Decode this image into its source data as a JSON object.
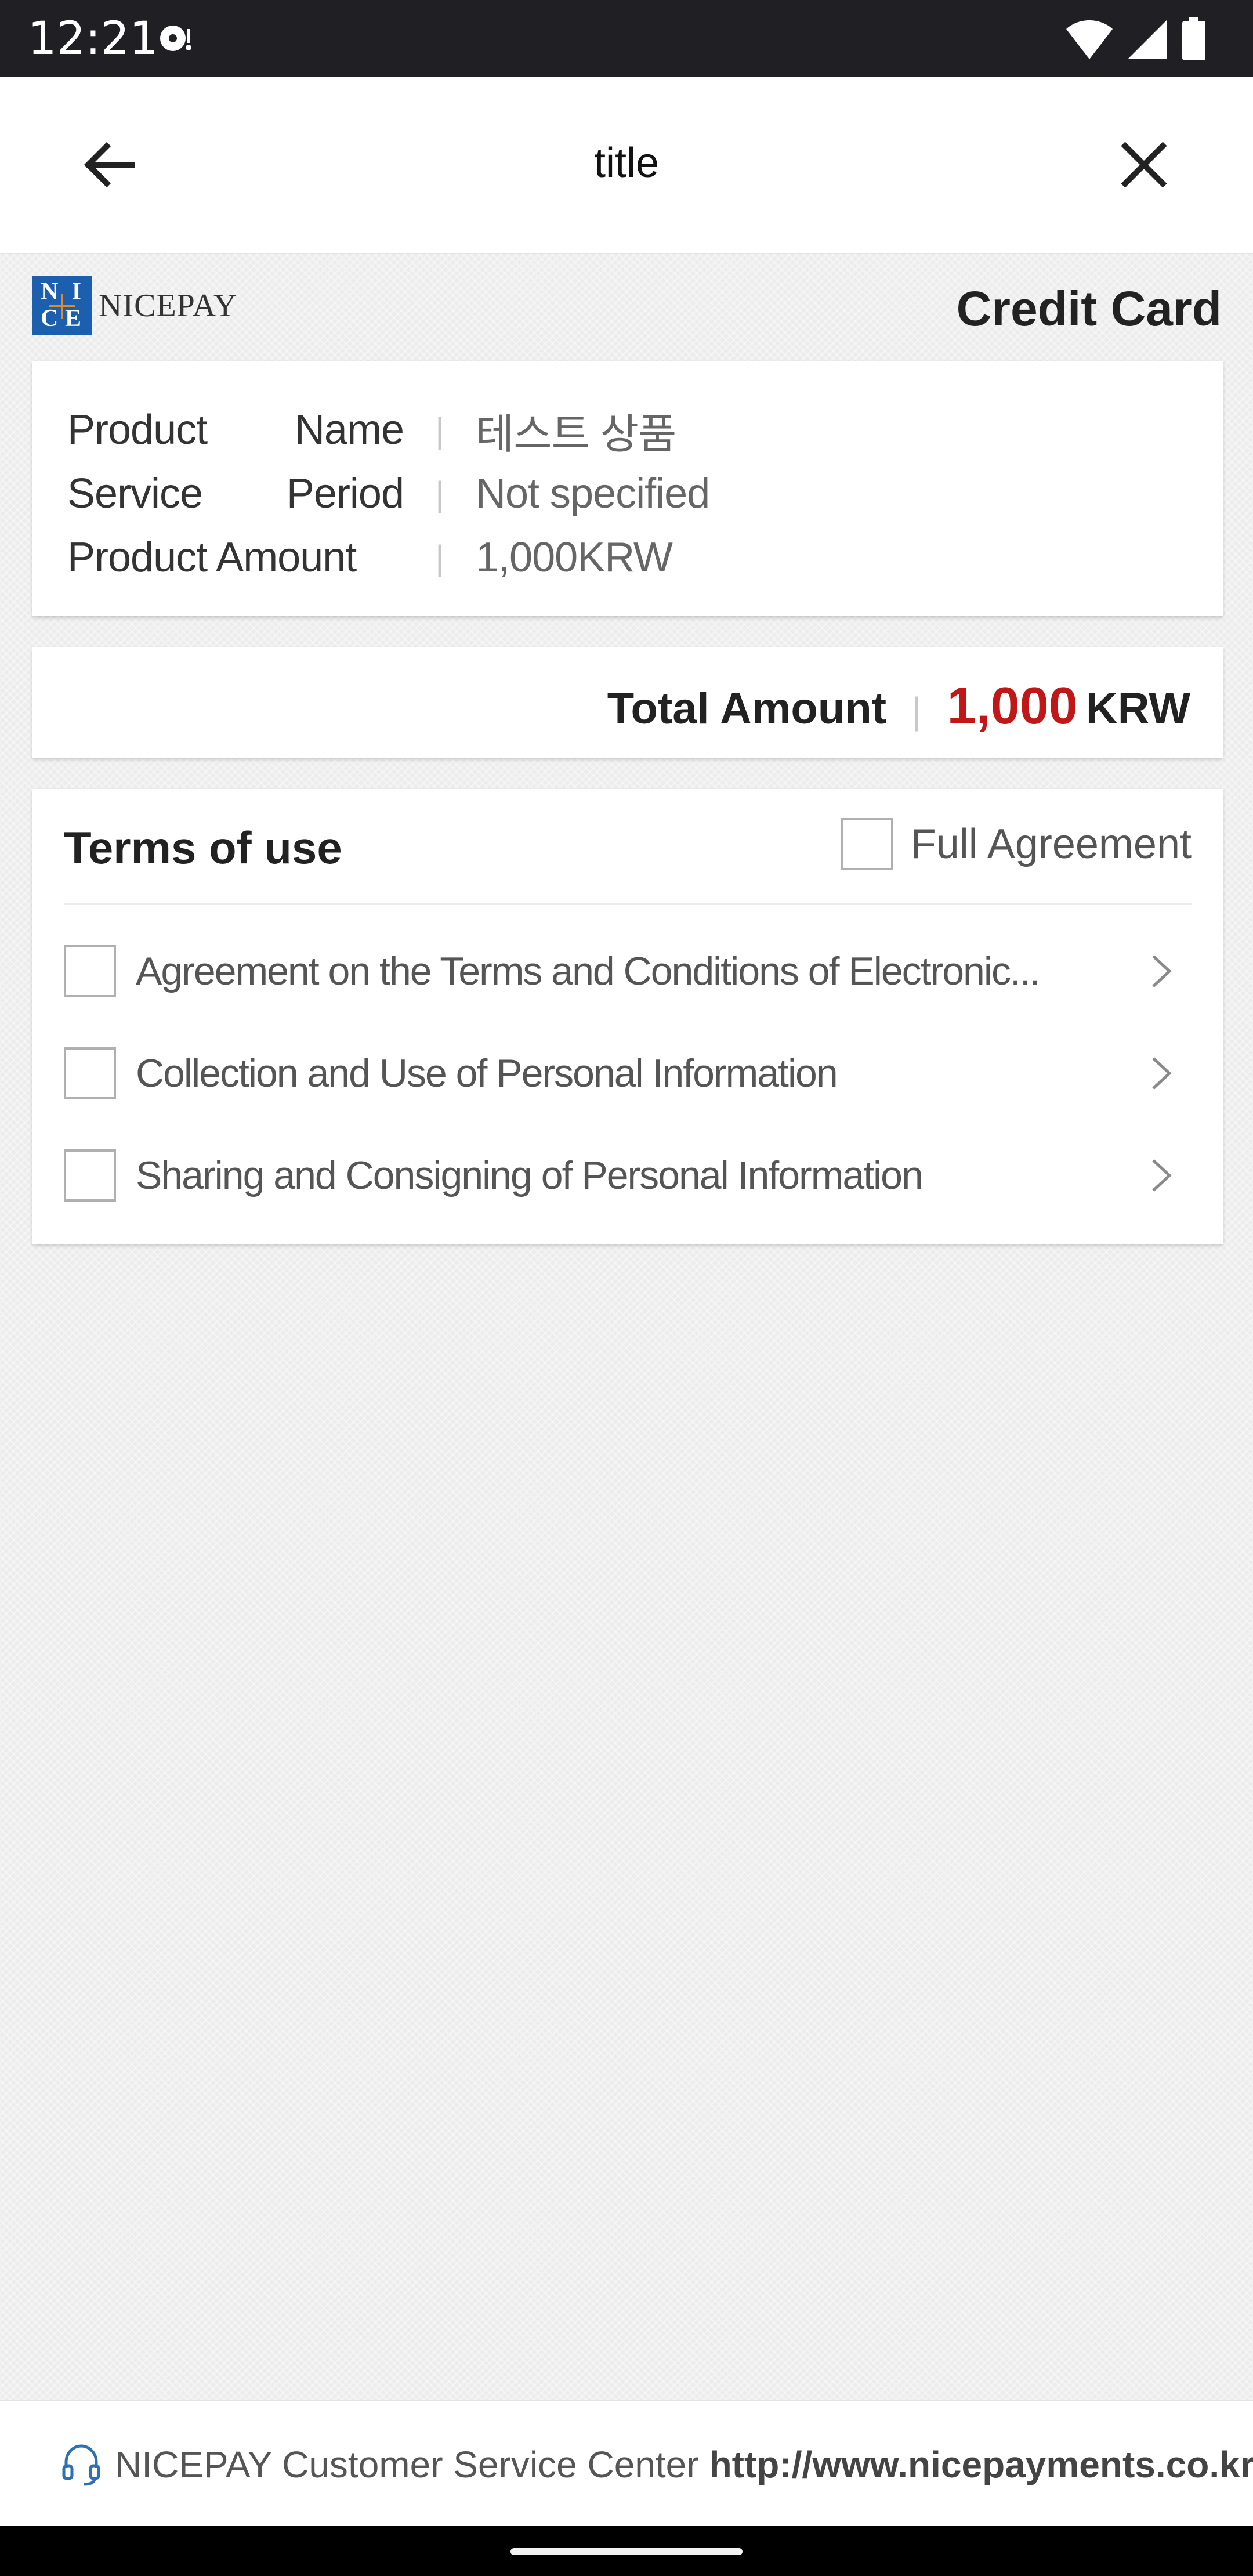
{
  "status_bar": {
    "time": "12:21",
    "icons": [
      "media-icon",
      "wifi-icon",
      "signal-icon",
      "battery-icon"
    ]
  },
  "app_bar": {
    "title": "title",
    "back_icon": "arrow-left-icon",
    "close_icon": "close-icon"
  },
  "brand": {
    "logo_text": "NICEPAY",
    "logo_letters": [
      "N",
      "I",
      "C",
      "E"
    ],
    "payment_method": "Credit Card"
  },
  "order_info": {
    "rows": [
      {
        "key_parts": [
          "Product",
          "Name"
        ],
        "value": "테스트 상품"
      },
      {
        "key_parts": [
          "Service",
          "Period"
        ],
        "value": "Not specified"
      },
      {
        "key_parts": [
          "Product Amount"
        ],
        "value": "1,000KRW"
      }
    ]
  },
  "total": {
    "label": "Total Amount",
    "amount": "1,000",
    "currency": "KRW"
  },
  "terms": {
    "title": "Terms of use",
    "full_agreement_label": "Full Agreement",
    "full_agreement_checked": false,
    "items": [
      {
        "label": "Agreement on the Terms and Conditions of Electronic...",
        "checked": false
      },
      {
        "label": "Collection and Use of Personal Information",
        "checked": false
      },
      {
        "label": "Sharing and Consigning of Personal Information",
        "checked": false
      }
    ]
  },
  "footer": {
    "text": "NICEPAY Customer Service Center",
    "url": "http://www.nicepayments.co.kr",
    "icon": "headset-icon"
  },
  "colors": {
    "accent_total": "#c01818",
    "logo_blue": "#1b5fae",
    "status_bar_bg": "#1f1f24"
  }
}
